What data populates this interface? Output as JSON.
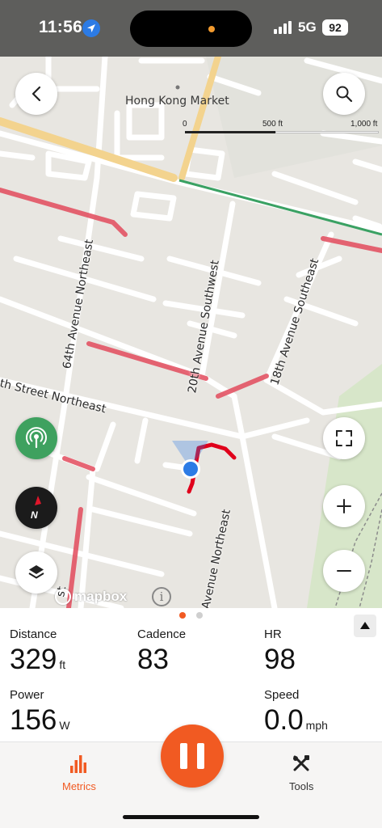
{
  "status_bar": {
    "time": "11:56",
    "network": "5G",
    "battery": "92"
  },
  "map": {
    "place_label": "Hong Kong Market",
    "scale": {
      "tick_0": "0",
      "tick_mid": "500 ft",
      "tick_max": "1,000 ft"
    },
    "streets": {
      "ave_64th": "64th Avenue Northeast",
      "ave_20th_sw": "20th Avenue Southwest",
      "ave_18th": "18th Avenue Southeast",
      "street_ne": "th Street Northeast",
      "ave_ne_lower": "Avenue Northeast",
      "st_lower_left": "st"
    },
    "attribution": "mapbox",
    "info_label": "i",
    "compass_label": "N"
  },
  "metrics": {
    "distance": {
      "label": "Distance",
      "value": "329",
      "unit": "ft"
    },
    "cadence": {
      "label": "Cadence",
      "value": "83"
    },
    "hr": {
      "label": "HR",
      "value": "98"
    },
    "power": {
      "label": "Power",
      "value": "156",
      "unit": "W"
    },
    "speed": {
      "label": "Speed",
      "value": "0.0",
      "unit": "mph"
    },
    "active_page": 1,
    "page_count": 2
  },
  "tabs": {
    "metrics": "Metrics",
    "tools": "Tools"
  },
  "colors": {
    "accent": "#f15a22",
    "live_track_green": "#3ea15f",
    "location_blue": "#2c7be5",
    "route_red": "#e0001b"
  }
}
